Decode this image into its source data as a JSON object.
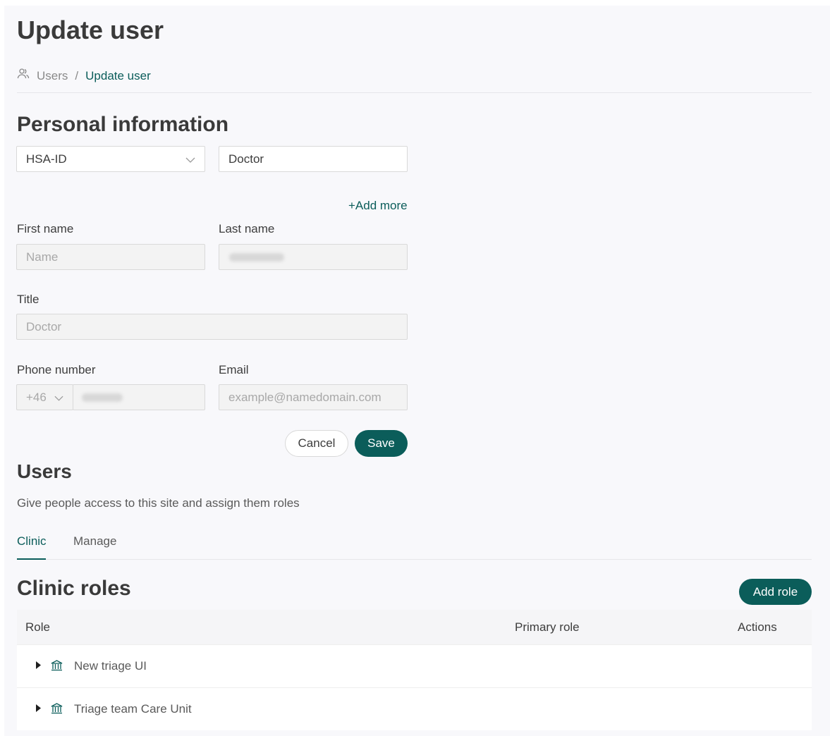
{
  "page": {
    "title": "Update user"
  },
  "breadcrumb": {
    "root": "Users",
    "separator": "/",
    "current": "Update user"
  },
  "personal": {
    "heading": "Personal information",
    "id_type": "HSA-ID",
    "id_value": "Doctor",
    "add_more": "+Add more",
    "first_name_label": "First name",
    "first_name_placeholder": "Name",
    "last_name_label": "Last name",
    "title_label": "Title",
    "title_placeholder": "Doctor",
    "phone_label": "Phone number",
    "country_code": "+46",
    "email_label": "Email",
    "email_placeholder": "example@namedomain.com",
    "cancel": "Cancel",
    "save": "Save"
  },
  "users": {
    "heading": "Users",
    "description": "Give people access to this site and assign them roles",
    "tabs": [
      "Clinic",
      "Manage"
    ]
  },
  "clinic_roles": {
    "heading": "Clinic roles",
    "add_role": "Add role",
    "columns": [
      "Role",
      "Primary role",
      "Actions"
    ],
    "rows": [
      {
        "name": "New triage UI"
      },
      {
        "name": "Triage team Care Unit"
      }
    ]
  },
  "colors": {
    "accent": "#0b5d5a",
    "background": "#f8f8fb"
  },
  "icons": {
    "breadcrumb": "users-icon",
    "row_expand": "caret-right-icon",
    "row_type": "institution-icon",
    "select": "chevron-down-icon"
  }
}
